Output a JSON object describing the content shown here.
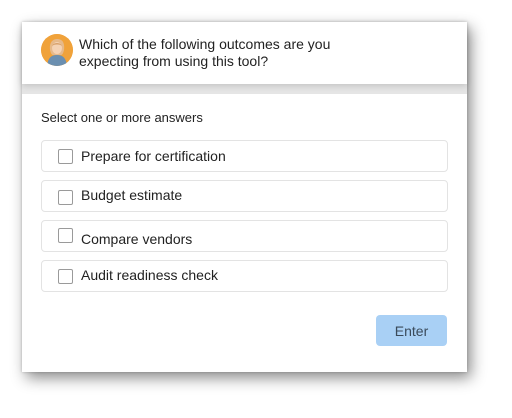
{
  "question": {
    "line1": "Which of the following outcomes are you",
    "line2": "expecting from using this tool?"
  },
  "instruction": "Select one or more answers",
  "options": [
    {
      "label": "Prepare for certification",
      "checked": false
    },
    {
      "label": "Budget estimate",
      "checked": false
    },
    {
      "label": "Compare vendors",
      "checked": false
    },
    {
      "label": "Audit readiness check",
      "checked": false
    }
  ],
  "enter_button": {
    "label": "Enter"
  },
  "colors": {
    "button_background": "#a9d0f5",
    "avatar_background": "#f0a23a",
    "divider_band": "#e5e5e5"
  }
}
